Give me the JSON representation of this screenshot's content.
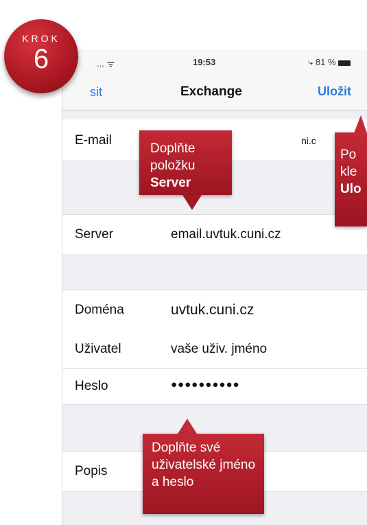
{
  "step": {
    "label": "KROK",
    "number": "6"
  },
  "status_bar": {
    "signal": "... ᯤ",
    "time": "19:53",
    "battery": "⤷ 81 %"
  },
  "nav": {
    "back_label": "sit",
    "title": "Exchange",
    "save_label": "Uložit"
  },
  "rows": {
    "email": {
      "label": "E-mail",
      "value": "ni.c"
    },
    "server": {
      "label": "Server",
      "value": "email.uvtuk.cuni.cz"
    },
    "domain": {
      "label": "Doména",
      "value": "uvtuk.cuni.cz"
    },
    "user": {
      "label": "Uživatel",
      "value": "vaše uživ. jméno"
    },
    "password": {
      "label": "Heslo",
      "value": "●●●●●●●●●●"
    },
    "description": {
      "label": "Popis",
      "value": ""
    }
  },
  "callouts": {
    "server": {
      "line1": "Doplňte položku",
      "line2": "Server"
    },
    "save": {
      "line1": "Po",
      "line2": "kle",
      "line3": "Ulo"
    },
    "credentials": {
      "line1": "Doplňte své",
      "line2": "uživatelské jméno",
      "line3": "a heslo"
    }
  }
}
